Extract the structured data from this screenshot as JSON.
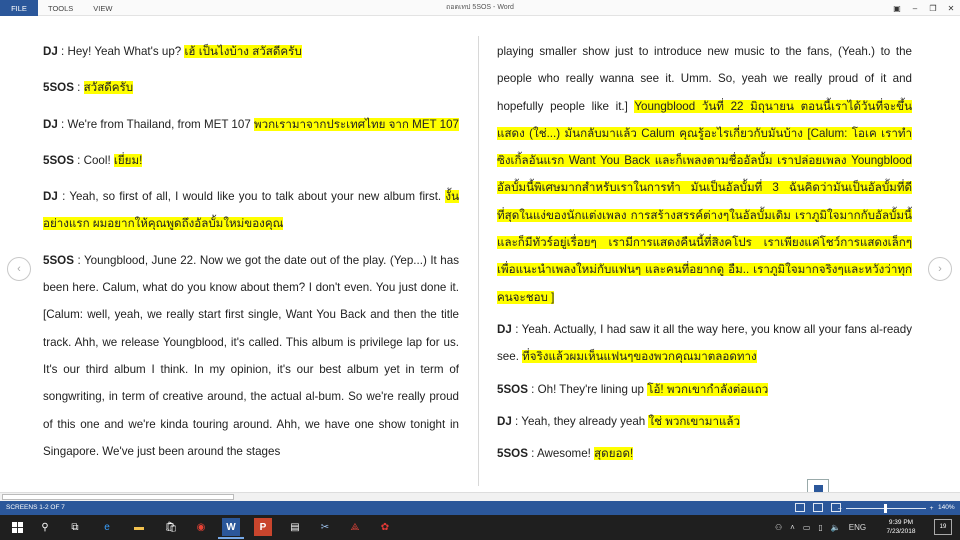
{
  "window": {
    "title": "ถอดเทป 5SOS - Word",
    "menu": [
      "FILE",
      "TOOLS",
      "VIEW"
    ]
  },
  "document": {
    "left": [
      {
        "speaker": "DJ",
        "text": " : Hey! Yeah What's up? ",
        "hl": "เฮ้ เป็นไงบ้าง สวัสดีครับ"
      },
      {
        "speaker": "5SOS",
        "text": "  : ",
        "hl": "สวัสดีครับ"
      },
      {
        "speaker": "DJ",
        "text": " : We're from Thailand, from MET 107 ",
        "hl": "พวกเรามาจากประเทศไทย จาก MET 107"
      },
      {
        "speaker": "5SOS",
        "text": " : Cool! ",
        "hl": "เยี่ยม!"
      },
      {
        "speaker": "DJ",
        "text": " : Yeah, so first of all, I would like you to talk about your new album first. ",
        "hl": "งั้นอย่างแรก ผมอยากให้คุณพูดถึงอัลบั้มใหม่ของคุณ"
      },
      {
        "speaker": "5SOS",
        "text": " : Youngblood, June 22. Now we got the date out of the play. (Yep...) It has been here. Calum, what do you know about them? I don't even. You just done it. [Calum: well, yeah, we really start first single, Want You Back and then the title track. Ahh, we release Youngblood, it's called. This album is privilege lap for us. It's our third album I think. In my opinion, it's our best album yet in term of songwriting, in term of creative around, the actual al-bum. So we're really proud of this one and we're kinda touring around. Ahh, we have one show tonight in Singapore. We've just been around the stages",
        "hl": ""
      }
    ],
    "right": [
      {
        "speaker": "",
        "text": "playing smaller show just to introduce new music to the fans, (Yeah.) to the people who really wanna see it. Umm. So, yeah we really proud of it and hopefully people like it.] ",
        "hl": "Youngblood วันที่ 22 มิถุนายน ตอนนี้เราได้วันที่จะขึ้นแสดง (ใช่...) มันกลับมาแล้ว Calum คุณรู้อะไรเกี่ยวกับมันบ้าง [Calum: โอเค เราทำซิงเกิ้ลอันแรก Want You Back และก็เพลงตามชื่ออัลบั้ม เราปล่อยเพลง Youngblood  อัลบั้มนี้พิเศษมากสำหรับเราในการทำ มันเป็นอัลบั้มที่ 3 ฉันคิดว่ามันเป็นอัลบั้มที่ดีที่สุดในแง่ของนักแต่งเพลง การสร้างสรรค์ต่างๆในอัลบั้มเดิม เราภูมิใจมากกับอัลบั้มนี้และก็มีทัวร์อยู่เรื่อยๆ เรามีการแสดงคืนนี้ที่สิงคโปร เราเพียงแค่โชว์การแสดงเล็กๆ เพื่อแนะนำเพลงใหม่กับแฟนๆ และคนที่อยากดู อืม.. เราภูมิใจมากจริงๆและหวังว่าทุกคนจะชอบ ]"
      },
      {
        "speaker": "DJ",
        "text": " : Yeah. Actually, I had saw it all the way here, you know all your fans al-ready see. ",
        "hl": "ที่จริงแล้วผมเห็นแฟนๆของพวกคุณมาตลอดทาง"
      },
      {
        "speaker": "5SOS",
        "text": " : Oh! They're lining up ",
        "hl": "โอ้! พวกเขากำลังต่อแถว"
      },
      {
        "speaker": "DJ",
        "text": " : Yeah, they already yeah ",
        "hl": "ใช่ พวกเขามาแล้ว"
      },
      {
        "speaker": "5SOS",
        "text": " : Awesome! ",
        "hl": "สุดยอด!"
      }
    ]
  },
  "status": {
    "screens": "SCREENS 1-2 OF 7",
    "zoom": "140%"
  },
  "taskbar": {
    "lang": "ENG",
    "time": "9:39 PM",
    "date": "7/23/2018",
    "notifications": "19"
  }
}
